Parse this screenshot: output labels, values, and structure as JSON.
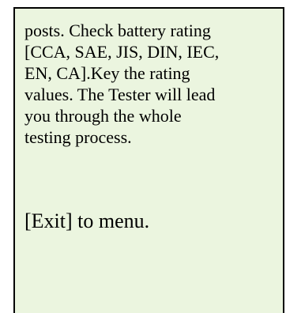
{
  "screen": {
    "background": "#ebf5df",
    "instructions_lines": [
      "posts. Check battery rating",
      "[CCA, SAE, JIS, DIN, IEC,",
      "EN, CA].Key the rating",
      "values. The Tester will lead",
      "you through the whole",
      "testing process."
    ],
    "exit_hint": "[Exit] to menu."
  }
}
